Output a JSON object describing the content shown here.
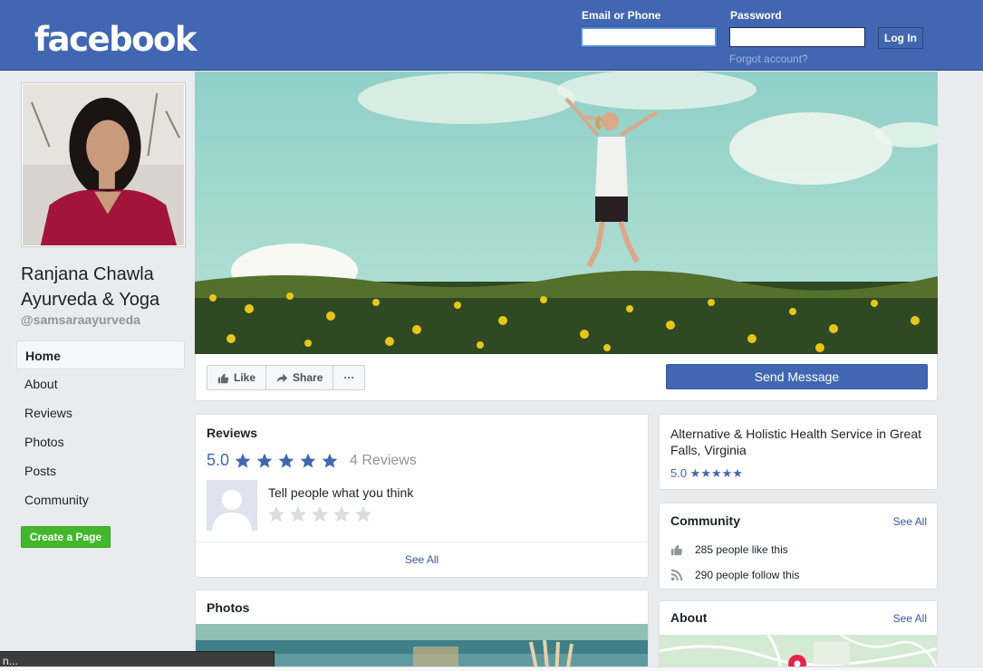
{
  "header": {
    "logo": "facebook",
    "email_label": "Email or Phone",
    "email_value": "",
    "password_label": "Password",
    "password_value": "",
    "login_button": "Log In",
    "forgot_link": "Forgot account?"
  },
  "page": {
    "name": "Ranjana Chawla Ayurveda & Yoga",
    "handle": "@samsaraayurveda"
  },
  "nav": {
    "items": [
      "Home",
      "About",
      "Reviews",
      "Photos",
      "Posts",
      "Community"
    ],
    "active": "Home"
  },
  "create_page_button": "Create a Page",
  "actions": {
    "like": "Like",
    "share": "Share",
    "more": "···",
    "send_message": "Send Message"
  },
  "reviews": {
    "title": "Reviews",
    "rating": "5.0",
    "stars": 5,
    "count_text": "4 Reviews",
    "prompt": "Tell people what you think",
    "see_all": "See All"
  },
  "photos": {
    "title": "Photos"
  },
  "info": {
    "category": "Alternative & Holistic Health Service in Great Falls, Virginia",
    "rating": "5.0 ★★★★★"
  },
  "community": {
    "title": "Community",
    "see_all": "See All",
    "likes": "285 people like this",
    "follows": "290 people follow this"
  },
  "about": {
    "title": "About",
    "see_all": "See All"
  },
  "status_tip": "n...",
  "colors": {
    "brand": "#4267b2",
    "link": "#365899",
    "green": "#42b72a",
    "background": "#e9ebee"
  }
}
